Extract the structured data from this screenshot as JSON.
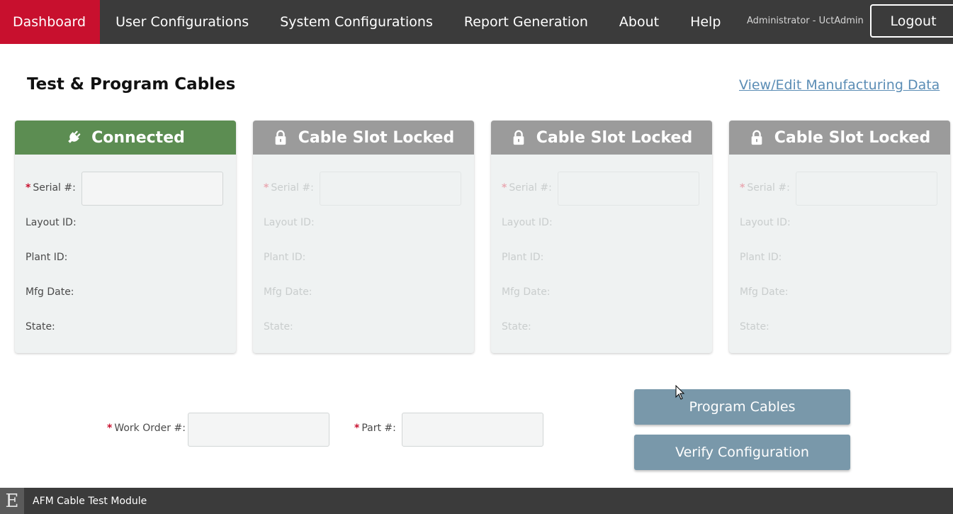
{
  "nav": {
    "items": [
      {
        "label": "Dashboard",
        "active": true
      },
      {
        "label": "User Configurations"
      },
      {
        "label": "System Configurations"
      },
      {
        "label": "Report Generation"
      },
      {
        "label": "About"
      },
      {
        "label": "Help"
      }
    ],
    "user": "Administrator - UctAdmin",
    "logout_label": "Logout"
  },
  "page": {
    "title": "Test & Program Cables",
    "mfg_link": "View/Edit Manufacturing Data"
  },
  "cards": [
    {
      "status": "Connected",
      "icon": "plug-icon",
      "state": "connected"
    },
    {
      "status": "Cable Slot Locked",
      "icon": "lock-icon",
      "state": "locked"
    },
    {
      "status": "Cable Slot Locked",
      "icon": "lock-icon",
      "state": "locked"
    },
    {
      "status": "Cable Slot Locked",
      "icon": "lock-icon",
      "state": "locked"
    }
  ],
  "card_fields": {
    "serial": "Serial #:",
    "layout": "Layout ID:",
    "plant": "Plant ID:",
    "mfg_date": "Mfg Date:",
    "state": "State:",
    "required_mark": "*"
  },
  "form": {
    "work_order_label": "Work Order #:",
    "part_label": "Part #:",
    "required_mark": "*"
  },
  "actions": {
    "program": "Program Cables",
    "verify": "Verify Configuration"
  },
  "footer": {
    "logo": "E",
    "app_name": "AFM Cable Test Module"
  },
  "colors": {
    "nav_bg": "#3b3b3b",
    "active_tab": "#c8102e",
    "connected": "#5c8d52",
    "locked": "#9b9b9b",
    "button": "#7998aa",
    "link": "#5b8db5"
  }
}
